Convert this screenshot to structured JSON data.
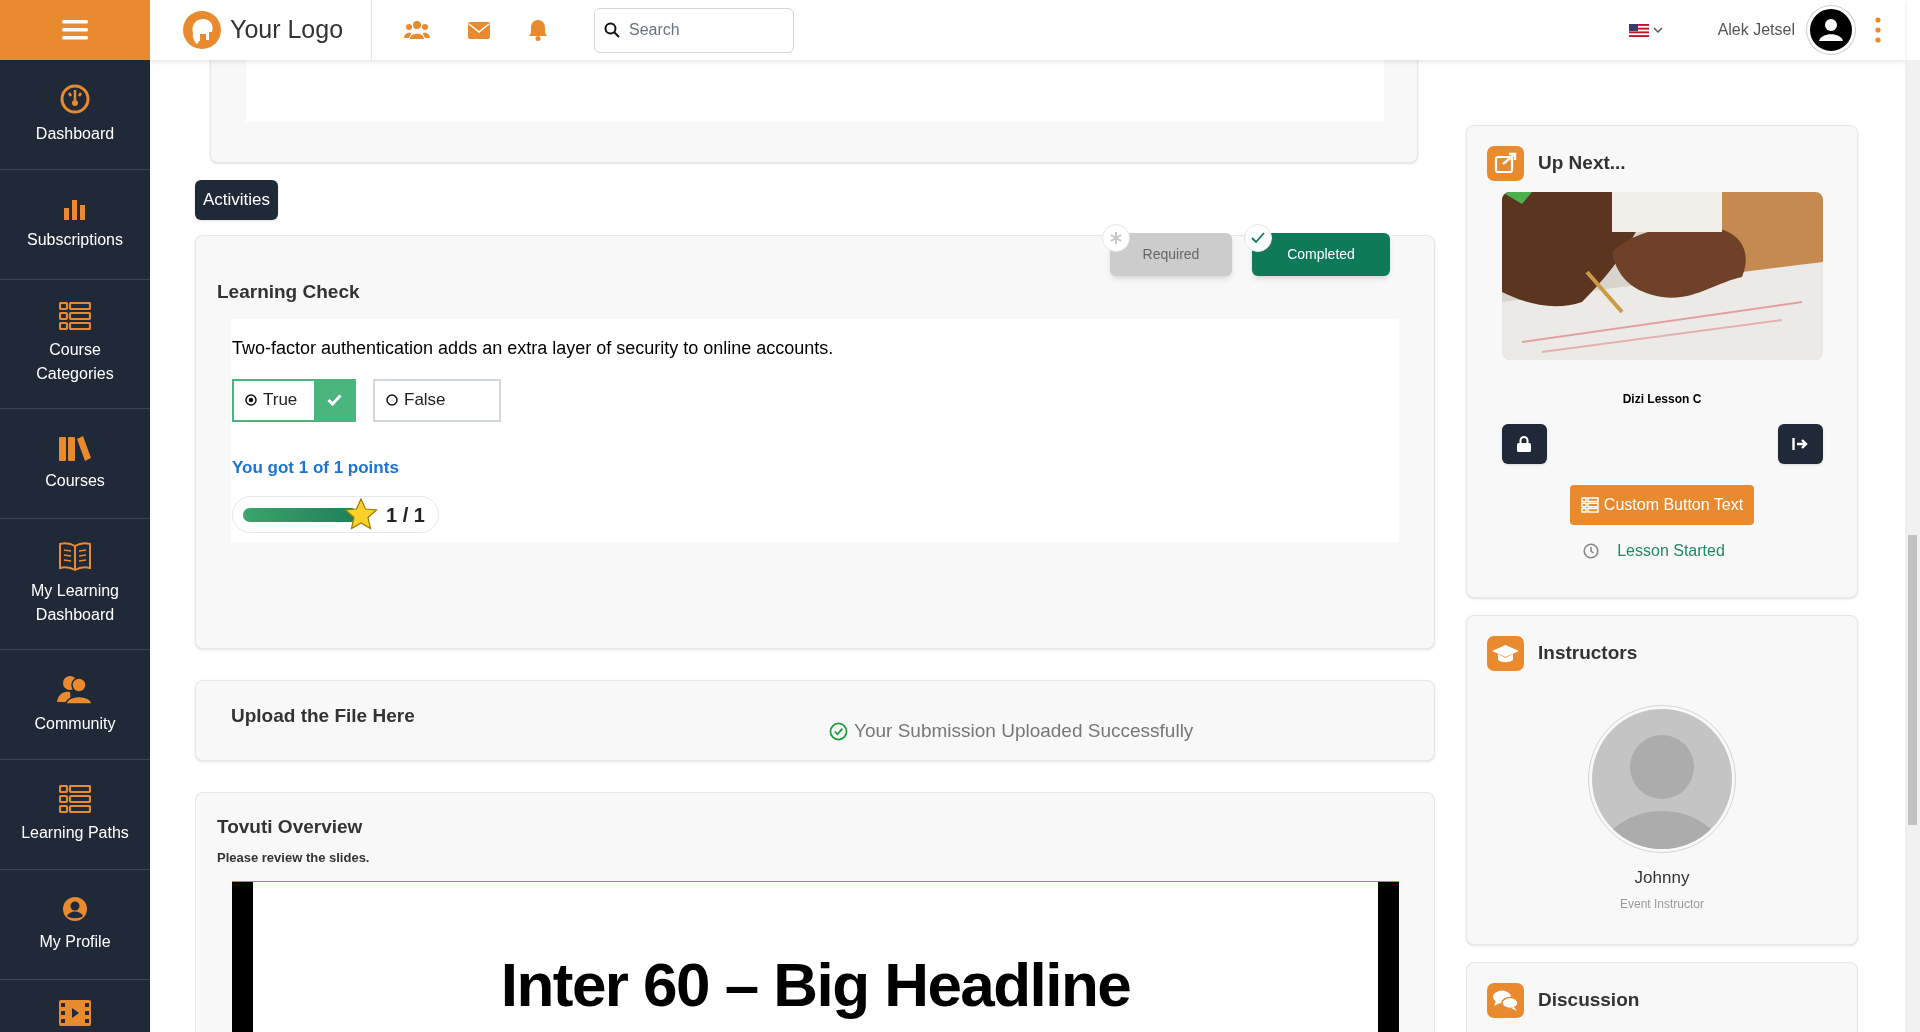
{
  "topbar": {
    "logo_text": "Your Logo",
    "search": {
      "placeholder": "Search"
    },
    "user_name": "Alek Jetsel"
  },
  "sidebar": {
    "items": [
      {
        "label": "Dashboard"
      },
      {
        "label": "Subscriptions"
      },
      {
        "label": "Course Categories"
      },
      {
        "label": "Courses"
      },
      {
        "label": "My Learning Dashboard"
      },
      {
        "label": "Community"
      },
      {
        "label": "Learning Paths"
      },
      {
        "label": "My Profile"
      }
    ]
  },
  "activities_tab": {
    "label": "Activities"
  },
  "learning_check": {
    "title": "Learning Check",
    "badges": [
      {
        "kind": "required",
        "label": "Required",
        "on": false
      },
      {
        "kind": "completed",
        "label": "Completed",
        "on": true
      }
    ],
    "question": "Two-factor authentication adds an extra layer of security to online accounts.",
    "options": [
      {
        "label": "True",
        "selected": true,
        "correct": true
      },
      {
        "label": "False",
        "selected": false
      }
    ],
    "result": "You got 1 of 1 points",
    "score": {
      "level": 1,
      "reading": "1 / 1"
    }
  },
  "upload": {
    "title": "Upload the File Here",
    "status": "Your Submission Uploaded Successfully"
  },
  "overview": {
    "title": "Tovuti Overview",
    "subtitle": "Please review the slides.",
    "slide_headline": "Inter 60 – Big Headline"
  },
  "up_next": {
    "title": "Up Next...",
    "lesson": "Dizi Lesson C",
    "button": "Custom Button Text",
    "status": "Lesson Started"
  },
  "instructors": {
    "title": "Instructors",
    "people": [
      {
        "name": "Johnny",
        "role": "Event Instructor"
      }
    ]
  },
  "discussion": {
    "title": "Discussion"
  }
}
